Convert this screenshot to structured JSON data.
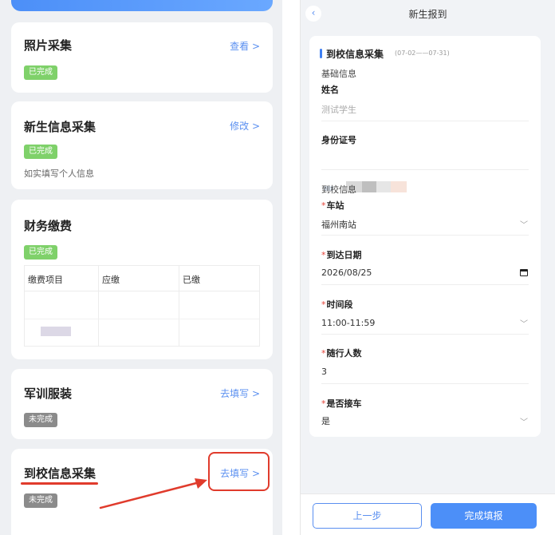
{
  "left": {
    "cards": {
      "photo": {
        "title": "照片采集",
        "link": "查看 >",
        "status": "已完成"
      },
      "info": {
        "title": "新生信息采集",
        "link": "修改 >",
        "status": "已完成",
        "hint": "如实填写个人信息"
      },
      "fee": {
        "title": "财务缴费",
        "status": "已完成",
        "columns": [
          "缴费项目",
          "应缴",
          "已缴"
        ]
      },
      "uniform": {
        "title": "军训服装",
        "link": "去填写 >",
        "status": "未完成"
      },
      "arrival": {
        "title": "到校信息采集",
        "link": "去填写 >",
        "status": "未完成"
      }
    }
  },
  "right": {
    "nav": {
      "back": "‹",
      "title": "新生报到"
    },
    "section": {
      "title": "到校信息采集",
      "range": "(07-02——07-31)"
    },
    "basic": {
      "group": "基础信息",
      "name_label": "姓名",
      "name_value": "测试学生",
      "id_label": "身份证号"
    },
    "arrival": {
      "group": "到校信息",
      "station_label": "车站",
      "station_value": "福州南站",
      "date_label": "到达日期",
      "date_value": "2026/08/25",
      "time_label": "时间段",
      "time_value": "11:00-11:59",
      "companions_label": "随行人数",
      "companions_value": "3",
      "pickup_label": "是否接车",
      "pickup_value": "是"
    },
    "buttons": {
      "prev": "上一步",
      "finish": "完成填报"
    }
  },
  "colors": {
    "accent": "#4c8ff8",
    "done": "#7fd16a",
    "todo": "#8b8b8b",
    "highlight": "#e03b2c"
  }
}
